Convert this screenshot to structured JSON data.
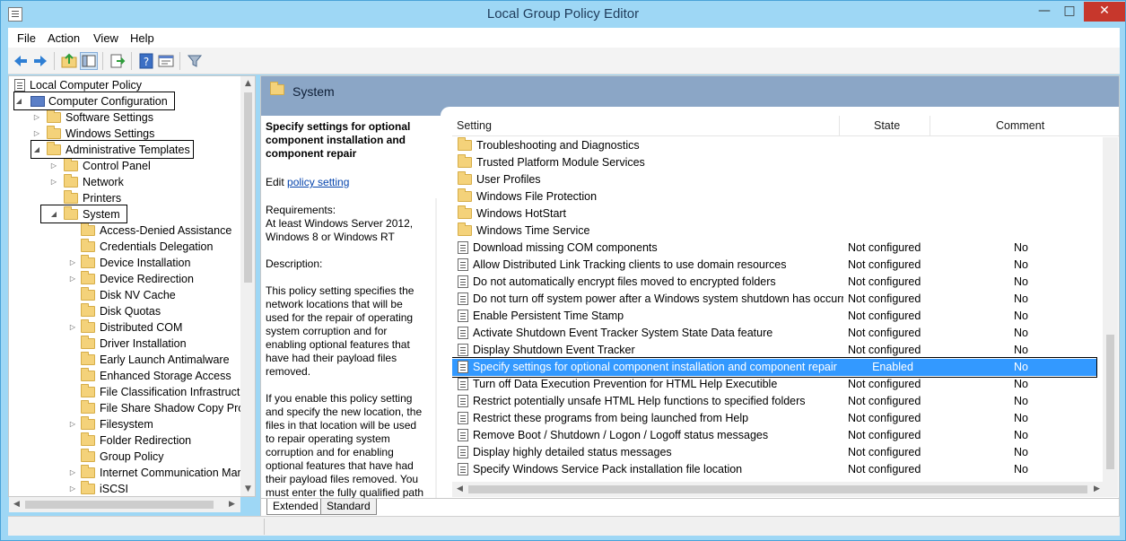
{
  "window": {
    "title": "Local Group Policy Editor"
  },
  "window_controls": {
    "minimize": "—",
    "maximize": "□",
    "close": "✕"
  },
  "menu": [
    "File",
    "Action",
    "View",
    "Help"
  ],
  "toolbar": {
    "buttons": [
      "back-icon",
      "forward-icon",
      "up-folder-icon",
      "show-hide-tree-icon",
      "export-list-icon",
      "help-icon",
      "properties-icon",
      "filter-icon"
    ]
  },
  "tree": {
    "root": "Local Computer Policy",
    "computer_configuration": "Computer Configuration",
    "software_settings": "Software Settings",
    "windows_settings": "Windows Settings",
    "administrative_templates": "Administrative Templates",
    "control_panel": "Control Panel",
    "network": "Network",
    "printers": "Printers",
    "system": "System",
    "system_children": [
      "Access-Denied Assistance",
      "Credentials Delegation",
      "Device Installation",
      "Device Redirection",
      "Disk NV Cache",
      "Disk Quotas",
      "Distributed COM",
      "Driver Installation",
      "Early Launch Antimalware",
      "Enhanced Storage Access",
      "File Classification Infrastructu",
      "File Share Shadow Copy Provi",
      "Filesystem",
      "Folder Redirection",
      "Group Policy",
      "Internet Communication Mar",
      "iSCSI"
    ]
  },
  "header": {
    "title": "System"
  },
  "description": {
    "title": "Specify settings for optional component installation and component repair",
    "edit_prefix": "Edit",
    "edit_link": "policy setting",
    "requirements_label": "Requirements:",
    "requirements_text": "At least Windows Server 2012, Windows 8 or Windows RT",
    "description_label": "Description:",
    "paragraph1": "This policy setting specifies the network locations that will be used for the repair of operating system corruption and for enabling optional features that have had their payload files removed.",
    "paragraph2": "If you enable this policy setting and specify the new location, the files in that location will be used to repair operating system corruption and for enabling optional features that have had their payload files removed. You must enter the fully qualified path"
  },
  "list": {
    "columns": {
      "setting": "Setting",
      "state": "State",
      "comment": "Comment"
    },
    "folders": [
      "Troubleshooting and Diagnostics",
      "Trusted Platform Module Services",
      "User Profiles",
      "Windows File Protection",
      "Windows HotStart",
      "Windows Time Service"
    ],
    "policies": [
      {
        "name": "Download missing COM components",
        "state": "Not configured",
        "comment": "No"
      },
      {
        "name": "Allow Distributed Link Tracking clients to use domain resources",
        "state": "Not configured",
        "comment": "No"
      },
      {
        "name": "Do not automatically encrypt files moved to encrypted folders",
        "state": "Not configured",
        "comment": "No"
      },
      {
        "name": "Do not turn off system power after a Windows system shutdown has occurr...",
        "state": "Not configured",
        "comment": "No"
      },
      {
        "name": "Enable Persistent Time Stamp",
        "state": "Not configured",
        "comment": "No"
      },
      {
        "name": "Activate Shutdown Event Tracker System State Data feature",
        "state": "Not configured",
        "comment": "No"
      },
      {
        "name": "Display Shutdown Event Tracker",
        "state": "Not configured",
        "comment": "No"
      },
      {
        "name": "Specify settings for optional component installation and component repair",
        "state": "Enabled",
        "comment": "No"
      },
      {
        "name": "Turn off Data Execution Prevention for HTML Help Executible",
        "state": "Not configured",
        "comment": "No"
      },
      {
        "name": "Restrict potentially unsafe HTML Help functions to specified folders",
        "state": "Not configured",
        "comment": "No"
      },
      {
        "name": "Restrict these programs from being launched from Help",
        "state": "Not configured",
        "comment": "No"
      },
      {
        "name": "Remove Boot / Shutdown / Logon / Logoff status messages",
        "state": "Not configured",
        "comment": "No"
      },
      {
        "name": "Display highly detailed status messages",
        "state": "Not configured",
        "comment": "No"
      },
      {
        "name": "Specify Windows Service Pack installation file location",
        "state": "Not configured",
        "comment": "No"
      }
    ]
  },
  "tabs": {
    "extended": "Extended",
    "standard": "Standard"
  },
  "colors": {
    "title_bar": "#9ed7f5",
    "header_band": "#8ba6c6",
    "selection": "#3399ff",
    "close_button": "#c7372c"
  }
}
